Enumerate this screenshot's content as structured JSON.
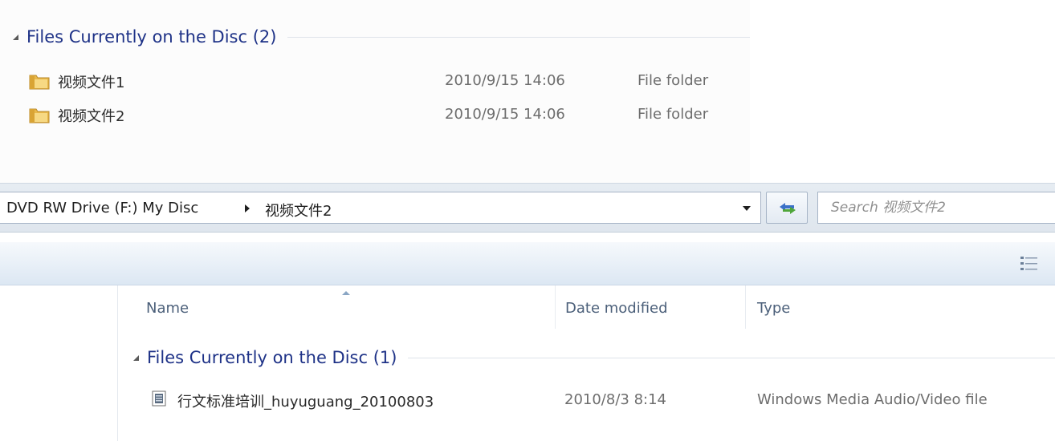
{
  "top_panel": {
    "group_title": "Files Currently on the Disc (2)",
    "items": [
      {
        "name": "视频文件1",
        "date": "2010/9/15 14:06",
        "type": "File folder",
        "icon": "folder-icon"
      },
      {
        "name": "视频文件2",
        "date": "2010/9/15 14:06",
        "type": "File folder",
        "icon": "folder-icon"
      }
    ]
  },
  "address_bar": {
    "breadcrumb": [
      {
        "label": "DVD RW Drive (F:) My Disc"
      },
      {
        "label": "视频文件2"
      }
    ],
    "search_placeholder": "Search 视频文件2",
    "icons": [
      "chevron-right-icon",
      "dropdown-arrow-icon",
      "refresh-icon"
    ]
  },
  "toolbar": {
    "icons": [
      "view-options-icon"
    ]
  },
  "file_list": {
    "columns": [
      {
        "label": "Name",
        "sorted": "ascending"
      },
      {
        "label": "Date modified"
      },
      {
        "label": "Type"
      }
    ],
    "group_title": "Files Currently on the Disc (1)",
    "items": [
      {
        "name": "行文标准培训_huyuguang_20100803",
        "date": "2010/8/3 8:14",
        "type": "Windows Media Audio/Video file",
        "icon": "media-file-icon"
      }
    ]
  },
  "colors": {
    "group_title": "#1e3287",
    "column_header": "#4c607a",
    "address_bar_bg": "#e2e9f0",
    "toolbar_bg": "#dce7f3"
  }
}
